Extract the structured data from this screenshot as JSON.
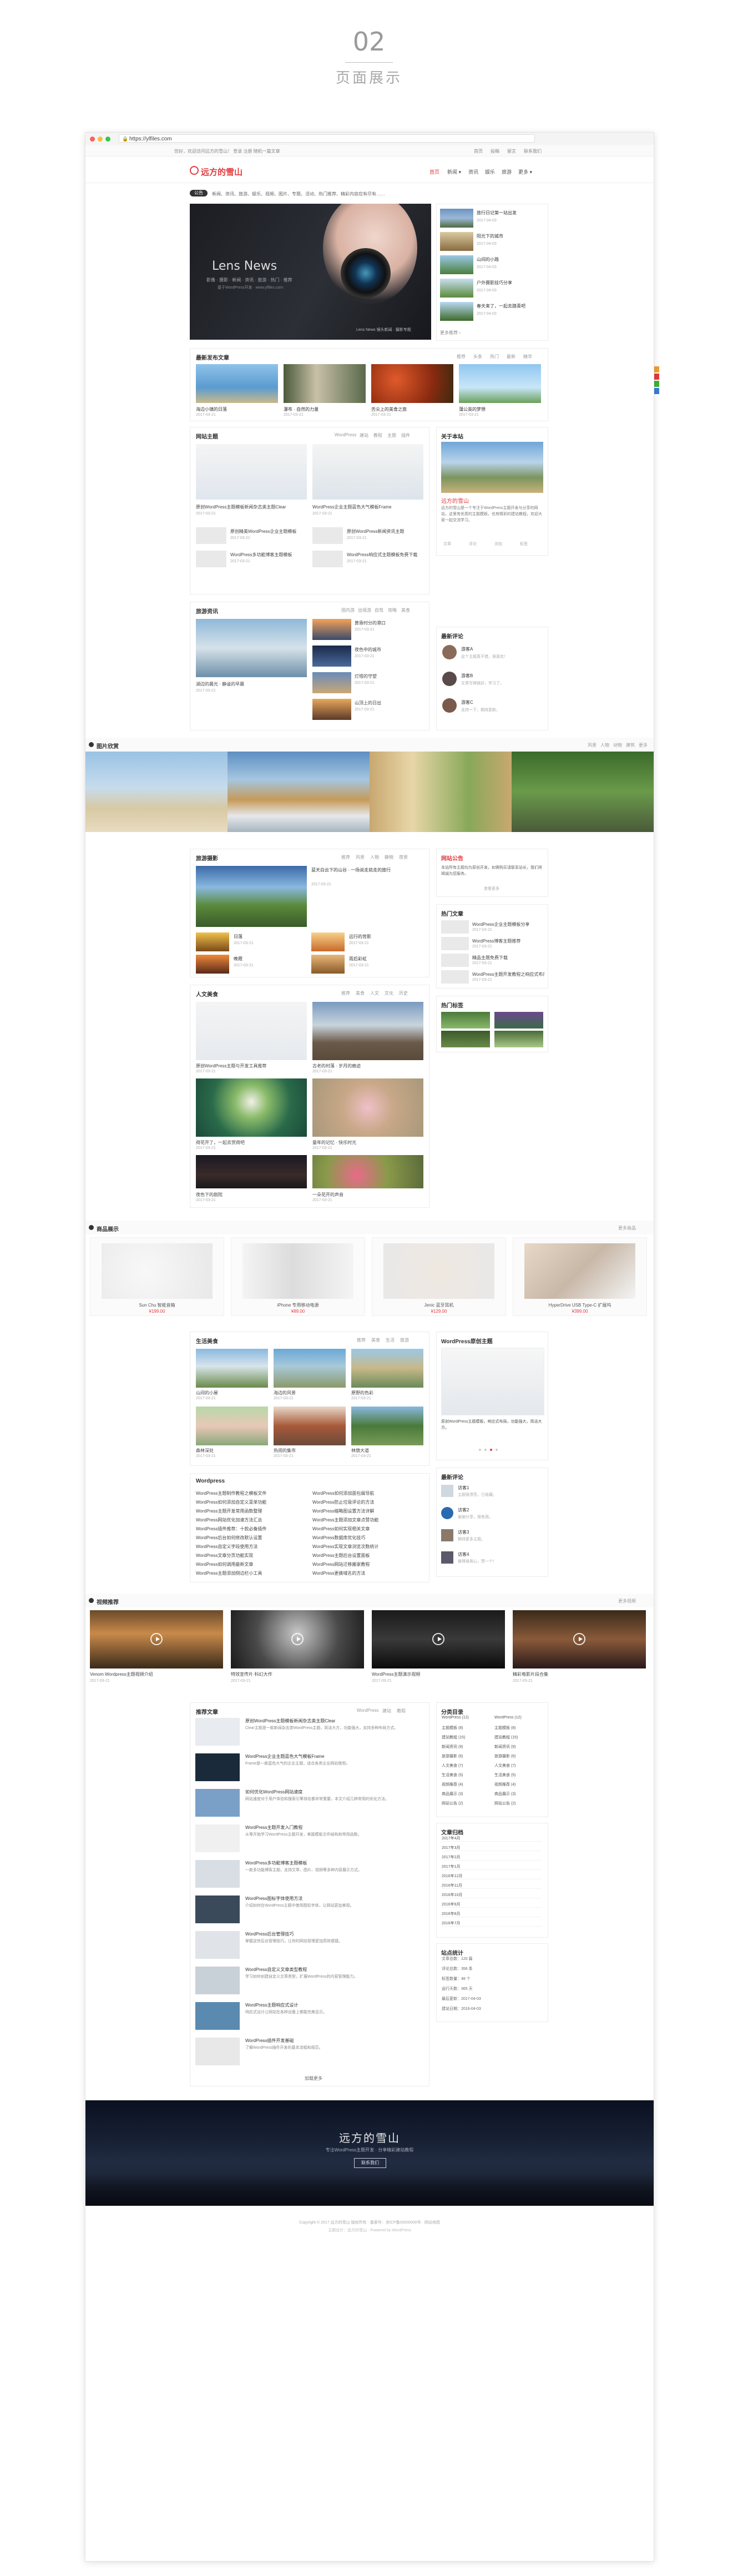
{
  "intro": {
    "number": "02",
    "title": "页面展示"
  },
  "browser": {
    "url": "https://ylfiles.com"
  },
  "topbar": {
    "left": "您好，欢迎访问远方的雪山！ 登录   注册   随机一篇文章   ",
    "links": [
      "首页",
      "投稿",
      "留言",
      "联系我们"
    ]
  },
  "site": {
    "logo": "远方的雪山",
    "nav": [
      "首页",
      "新闻 ▾",
      "资讯",
      "娱乐",
      "旅游",
      "更多 ▾"
    ]
  },
  "ticker": {
    "badge": "公告",
    "text": "新闻、资讯、旅游、娱乐、视频、图片、专题、活动、热门推荐、精彩内容应有尽有……"
  },
  "slider": {
    "heading": "Lens News",
    "sub": "影像 · 摄影 · 新闻 · 资讯 · 旅游 · 热门 · 推荐",
    "sub2": "基于WordPress开发 · www.ylfiles.com",
    "caption": "Lens News 镜头新闻 · 摄影专题"
  },
  "side_news": {
    "items": [
      {
        "title": "旅行日记第一站出发",
        "date": "2017-04-03"
      },
      {
        "title": "阳光下的城市",
        "date": "2017-04-03"
      },
      {
        "title": "山间的小路",
        "date": "2017-04-03"
      },
      {
        "title": "户外摄影技巧分享",
        "date": "2017-04-03"
      },
      {
        "title": "春天来了，一起去踏青吧",
        "date": "2017-04-03"
      }
    ],
    "more": "更多推荐 ›"
  },
  "recent": {
    "title": "最新发布文章",
    "tabs": [
      "推荐",
      "头条",
      "热门",
      "最新",
      "精华"
    ],
    "items": [
      {
        "title": "海边小镇的日落",
        "date": "2017-03-21"
      },
      {
        "title": "瀑布 · 自然的力量",
        "date": "2017-03-21"
      },
      {
        "title": "舌尖上的美食之旅",
        "date": "2017-03-21"
      },
      {
        "title": "蒲公英的梦想",
        "date": "2017-03-21"
      }
    ]
  },
  "tech": {
    "title": "网站主题",
    "tabs": [
      "WordPress",
      "建站",
      "教程",
      "主题",
      "插件"
    ],
    "big": [
      {
        "title": "原创WordPress主题模板新闻杂志类主题Clear",
        "date": "2017-03-21"
      },
      {
        "title": "WordPress企业主题蓝色大气模板Frame",
        "date": "2017-03-21"
      }
    ],
    "small": [
      {
        "title": "原创精美WordPress企业主题模板",
        "date": "2017-03-21"
      },
      {
        "title": "WordPress多功能博客主题模板",
        "date": "2017-03-21"
      },
      {
        "title": "原创WordPress新闻资讯主题",
        "date": "2017-03-21"
      },
      {
        "title": "WordPress响应式主题模板免费下载",
        "date": "2017-03-21"
      }
    ]
  },
  "about": {
    "title": "关于本站",
    "name": "远方的雪山",
    "desc": "远方的雪山是一个专注于WordPress主题开发与分享的网站，这里有优质的主题模板，也有精彩的建站教程，欢迎大家一起交流学习。",
    "stats": [
      "文章",
      "评论",
      "浏览",
      "标签"
    ]
  },
  "travel": {
    "title": "旅游资讯",
    "tabs": [
      "国内游",
      "出境游",
      "自驾",
      "攻略",
      "美食"
    ],
    "big": {
      "title": "湖边的晨光 · 静谧的早晨",
      "date": "2017-03-21"
    },
    "items": [
      {
        "title": "黄昏时分的港口",
        "date": "2017-03-21"
      },
      {
        "title": "夜色中的城市",
        "date": "2017-03-21"
      },
      {
        "title": "灯塔的守望",
        "date": "2017-03-21"
      },
      {
        "title": "山顶上的日出",
        "date": "2017-03-21"
      }
    ]
  },
  "readers": {
    "title": "最新评论",
    "items": [
      {
        "name": "游客A",
        "text": "这个主题真不错，很喜欢！"
      },
      {
        "name": "游客B",
        "text": "文章写得很好，学习了。"
      },
      {
        "name": "游客C",
        "text": "支持一下，期待更新。"
      }
    ]
  },
  "gallery": {
    "title": "图片欣赏",
    "tabs": [
      "风景",
      "人物",
      "动物",
      "建筑",
      "更多"
    ]
  },
  "scenery": {
    "title": "旅游摄影",
    "tabs": [
      "推荐",
      "风景",
      "人物",
      "静物",
      "夜景"
    ],
    "big": {
      "title": "蓝天白云下的山谷 · 一场说走就走的旅行",
      "date": "2017-03-21"
    },
    "items": [
      {
        "title": "日落",
        "date": "2017-03-21"
      },
      {
        "title": "晚霞",
        "date": "2017-03-21"
      }
    ],
    "side": [
      {
        "title": "远行的背影",
        "date": "2017-03-21"
      },
      {
        "title": "雨后彩虹",
        "date": "2017-03-21"
      }
    ]
  },
  "notice": {
    "title": "网站公告",
    "text": "本站所有主题均为原创开发，如需购买请联系站长，我们将竭诚为您服务。",
    "more": "查看更多"
  },
  "hot": {
    "title": "热门文章",
    "items": [
      {
        "title": "WordPress企业主题模板分享",
        "date": "2017-03-21"
      },
      {
        "title": "WordPress博客主题推荐",
        "date": "2017-03-21"
      },
      {
        "title": "精品主题免费下载",
        "date": "2017-03-21"
      },
      {
        "title": "WordPress主题开发教程之响应式布局",
        "date": "2017-03-21"
      }
    ]
  },
  "people": {
    "title": "人文美食",
    "tabs": [
      "推荐",
      "美食",
      "人文",
      "文化",
      "历史"
    ],
    "items": [
      {
        "title": "原创WordPress主题与开发工具推荐",
        "date": "2017-03-21"
      },
      {
        "title": "古老的村落 · 岁月的痕迹",
        "date": "2017-03-21"
      },
      {
        "title": "荷花开了，一起去赏荷吧",
        "date": "2017-03-21"
      },
      {
        "title": "童年的记忆 · 快乐时光",
        "date": "2017-03-21"
      },
      {
        "title": "夜色下的剧院",
        "date": "2017-03-21"
      },
      {
        "title": "一朵花开的声音",
        "date": "2017-03-21"
      }
    ]
  },
  "tags": {
    "title": "热门标签"
  },
  "products": {
    "title": "商品展示",
    "more": "更多商品",
    "items": [
      {
        "name": "Sun Chu 智能音箱",
        "price": "¥199.00"
      },
      {
        "name": "iPhone 专用移动电源",
        "price": "¥89.00"
      },
      {
        "name": "Jenic 蓝牙耳机",
        "price": "¥129.00"
      },
      {
        "name": "HyperDrive USB Type-C 扩展坞",
        "price": "¥399.00"
      }
    ]
  },
  "food": {
    "title": "生活美食",
    "tabs": [
      "推荐",
      "美食",
      "生活",
      "旅游"
    ],
    "items": [
      {
        "title": "山间的小屋",
        "date": "2017-03-21"
      },
      {
        "title": "海边的风景",
        "date": "2017-03-21"
      },
      {
        "title": "原野的色彩",
        "date": "2017-03-21"
      },
      {
        "title": "森林深处",
        "date": "2017-03-21"
      },
      {
        "title": "热闹的集市",
        "date": "2017-03-21"
      },
      {
        "title": "林荫大道",
        "date": "2017-03-21"
      }
    ]
  },
  "wp_theme": {
    "title": "WordPress原创主题",
    "desc": "原创WordPress主题模板，响应式布局，功能强大，简洁大方。"
  },
  "comments": {
    "title": "最新评论",
    "items": [
      {
        "name": "访客1",
        "text": "主题很漂亮，已收藏。"
      },
      {
        "name": "访客2",
        "text": "谢谢分享，很有用。"
      },
      {
        "name": "访客3",
        "text": "期待更多主题。"
      },
      {
        "name": "访客4",
        "text": "做得很用心，赞一个！"
      }
    ]
  },
  "wordpress_list": {
    "title": "Wordpress",
    "left": [
      "WordPress主题制作教程之模板文件",
      "WordPress如何添加自定义菜单功能",
      "WordPress主题开发常用函数整理",
      "WordPress网站优化加速方法汇总",
      "WordPress插件推荐：十款必备插件",
      "WordPress后台如何修改默认设置",
      "WordPress自定义字段使用方法",
      "WordPress文章分页功能实现",
      "WordPress如何调用最新文章",
      "WordPress主题添加侧边栏小工具"
    ],
    "right": [
      "WordPress如何添加面包屑导航",
      "WordPress防止垃圾评论的方法",
      "WordPress缩略图设置方法详解",
      "WordPress主题添加文章点赞功能",
      "WordPress如何实现相关文章",
      "WordPress数据库优化技巧",
      "WordPress实现文章浏览次数统计",
      "WordPress主题后台设置面板",
      "WordPress网站迁移搬家教程",
      "WordPress更换域名的方法"
    ]
  },
  "video": {
    "title": "视频推荐",
    "more": "更多视频",
    "items": [
      {
        "title": "Venom Wordpress主题视频介绍",
        "date": "2017-03-21"
      },
      {
        "title": "特效宣传片·科幻大作",
        "date": "2017-03-21"
      },
      {
        "title": "WordPress主题演示视频",
        "date": "2017-03-21"
      },
      {
        "title": "精彩电影片段合集",
        "date": "2017-03-21"
      }
    ]
  },
  "blog": {
    "title": "推荐文章",
    "tabs": [
      "WordPress",
      "建站",
      "教程"
    ],
    "items": [
      {
        "title": "原创WordPress主题模板新闻杂志类主题Clear",
        "desc": "Clear主题是一款新闻杂志类WordPress主题，简洁大方，功能强大，支持多种布局方式。"
      },
      {
        "title": "WordPress企业主题蓝色大气模板Frame",
        "desc": "Frame是一款蓝色大气的企业主题，适合各类企业网站使用。"
      },
      {
        "title": "如何优化WordPress网站速度",
        "desc": "网站速度对于用户体验和搜索引擎排名都非常重要，本文介绍几种常用的优化方法。"
      },
      {
        "title": "WordPress主题开发入门教程",
        "desc": "从零开始学习WordPress主题开发，掌握模板文件结构和常用函数。"
      },
      {
        "title": "WordPress多功能博客主题模板",
        "desc": "一款多功能博客主题，支持文章、图片、视频等多种内容展示方式。"
      },
      {
        "title": "WordPress图标字体使用方法",
        "desc": "介绍如何在WordPress主题中使用图标字体，让网站更加美观。"
      },
      {
        "title": "WordPress后台管理技巧",
        "desc": "掌握这些后台管理技巧，让你的网站管理更加高效便捷。"
      },
      {
        "title": "WordPress自定义文章类型教程",
        "desc": "学习如何创建自定义文章类型，扩展WordPress的内容管理能力。"
      },
      {
        "title": "WordPress主题响应式设计",
        "desc": "响应式设计让网站在各种设备上都能完美显示。"
      },
      {
        "title": "WordPress插件开发基础",
        "desc": "了解WordPress插件开发的基本流程和规范。"
      }
    ],
    "more": "加载更多"
  },
  "cats": {
    "title": "分类目录",
    "left": [
      "WordPress (12)",
      "主题模板 (8)",
      "建站教程 (15)",
      "新闻资讯 (9)",
      "旅游摄影 (6)",
      "人文美食 (7)",
      "生活美食 (5)",
      "视频推荐 (4)",
      "商品展示 (3)",
      "网站公告 (2)"
    ],
    "right": [
      "WordPress (12)",
      "主题模板 (8)",
      "建站教程 (15)",
      "新闻资讯 (9)",
      "旅游摄影 (6)",
      "人文美食 (7)",
      "生活美食 (5)",
      "视频推荐 (4)",
      "商品展示 (3)",
      "网站公告 (2)"
    ]
  },
  "archive": {
    "title": "文章归档",
    "rows": [
      "2017年4月",
      "2017年3月",
      "2017年2月",
      "2017年1月",
      "2016年12月",
      "2016年11月",
      "2016年10月",
      "2016年9月",
      "2016年8月",
      "2016年7月"
    ]
  },
  "links_box": {
    "title": "站点统计",
    "rows": [
      "文章总数：120 篇",
      "评论总数：356 条",
      "标签数量：48 个",
      "运行天数：365 天",
      "最后更新：2017-04-03",
      "建站日期：2016-04-03"
    ]
  },
  "footer": {
    "brand": "远方的雪山",
    "slogan": "专注WordPress主题开发 · 分享精彩建站教程",
    "button": "联系我们",
    "copy": "Copyright © 2017 远方的雪山 版权所有 · 备案号：京ICP备00000000号 · 网站地图",
    "copy2": "主题设计：远方的雪山 · Powered by WordPress"
  }
}
